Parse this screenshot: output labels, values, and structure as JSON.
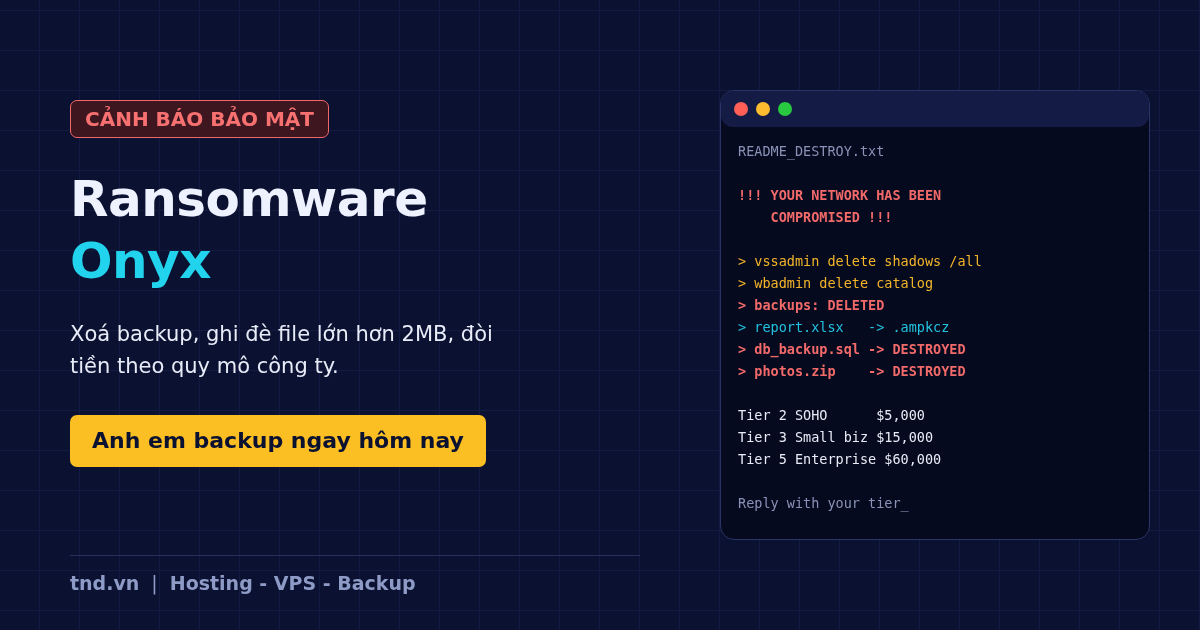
{
  "badge": "CẢNH BÁO BẢO MẬT",
  "title": {
    "line_1": "Ransomware",
    "line_2": "Onyx"
  },
  "description": "Xoá backup, ghi đè file lớn hơn 2MB, đòi tiền theo quy mô công ty.",
  "cta_button": "Anh em backup ngay hôm nay",
  "footer": {
    "site": "tnd.vn",
    "separator": "|",
    "tagline": "Hosting - VPS - Backup"
  },
  "terminal": {
    "blocks": [
      {
        "lines": [
          {
            "kind": "muted",
            "text": "README_DESTROY.txt"
          }
        ]
      },
      {
        "lines": [
          {
            "kind": "alert",
            "text": "!!! YOUR NETWORK HAS BEEN COMPROMISED !!!"
          }
        ]
      },
      {
        "lines": [
          {
            "kind": "command",
            "text": "> vssadmin delete shadows /all"
          },
          {
            "kind": "command",
            "text": "> wbadmin delete catalog"
          },
          {
            "kind": "danger",
            "text": "> backups: DELETED"
          },
          {
            "kind": "encrypted",
            "text": "> report.xlsx   -> .ampkcz"
          },
          {
            "kind": "danger",
            "text": "> db_backup.sql -> DESTROYED"
          },
          {
            "kind": "danger",
            "text": "> photos.zip    -> DESTROYED"
          }
        ]
      },
      {
        "lines": [
          {
            "kind": "plain",
            "text": "Tier 2 SOHO      $5,000"
          },
          {
            "kind": "plain",
            "text": "Tier 3 Small biz $15,000"
          },
          {
            "kind": "plain",
            "text": "Tier 5 Enterprise $60,000"
          }
        ]
      },
      {
        "lines": [
          {
            "kind": "muted",
            "text": "Reply with your tier_"
          }
        ]
      }
    ]
  }
}
